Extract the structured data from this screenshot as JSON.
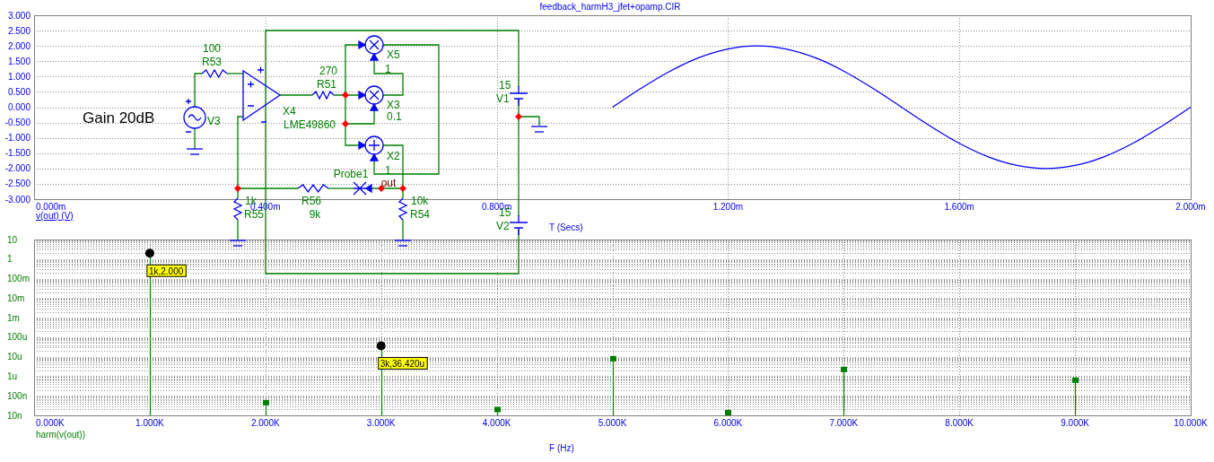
{
  "top_chart": {
    "chart_data": {
      "type": "line",
      "title": "feedback_harmH3_jfet+opamp.CIR",
      "xlabel": "T (Secs)",
      "grid": true,
      "x": [
        1,
        1.05,
        1.1,
        1.15,
        1.2,
        1.25,
        1.3,
        1.35,
        1.4,
        1.45,
        1.5,
        1.55,
        1.6,
        1.65,
        1.7,
        1.75,
        1.8,
        1.85,
        1.9,
        1.95,
        2
      ],
      "series": [
        {
          "name": "v(out) (V)",
          "color": "#0000ff",
          "values": [
            0,
            0.62,
            1.18,
            1.62,
            1.9,
            2,
            1.9,
            1.62,
            1.18,
            0.62,
            0,
            -0.62,
            -1.18,
            -1.62,
            -1.9,
            -2,
            -1.9,
            -1.62,
            -1.18,
            -0.62,
            0
          ]
        }
      ],
      "xlim": [
        0,
        2
      ],
      "ylim": [
        -3,
        3
      ],
      "xticks": [
        {
          "value": 0,
          "label": "0.000m"
        },
        {
          "value": 0.4,
          "label": "0.400m"
        },
        {
          "value": 0.8,
          "label": "0.800m"
        },
        {
          "value": 1.2,
          "label": "1.200m"
        },
        {
          "value": 1.6,
          "label": "1.600m"
        },
        {
          "value": 2,
          "label": "2.000m"
        }
      ],
      "yticks": [
        {
          "value": 3,
          "label": "3.000"
        },
        {
          "value": 2.5,
          "label": "2.500"
        },
        {
          "value": 2,
          "label": "2.000"
        },
        {
          "value": 1.5,
          "label": "1.500"
        },
        {
          "value": 1,
          "label": "1.000"
        },
        {
          "value": 0.5,
          "label": "0.500"
        },
        {
          "value": 0,
          "label": "0.000"
        },
        {
          "value": -0.5,
          "label": "-0.500"
        },
        {
          "value": -1,
          "label": "-1.000"
        },
        {
          "value": -1.5,
          "label": "-1.500"
        },
        {
          "value": -2,
          "label": "-2.000"
        },
        {
          "value": -2.5,
          "label": "-2.500"
        },
        {
          "value": -3,
          "label": "-3.000"
        }
      ]
    }
  },
  "bottom_chart": {
    "y_axis_labels": [
      "10",
      "1",
      "100m",
      "10m",
      "1m",
      "100u",
      "10u",
      "1u",
      "100n",
      "10n"
    ],
    "x_axis_labels": [
      "0.000K",
      "1.000K",
      "2.000K",
      "3.000K",
      "4.000K",
      "5.000K",
      "6.000K",
      "7.000K",
      "8.000K",
      "9.000K",
      "10.000K"
    ],
    "series_label": "harm(v(out))",
    "xlabel": "F (Hz)",
    "cursor_readouts": [
      "1k,2.000",
      "3k,36.420u"
    ]
  },
  "schematic": {
    "annotation": "Gain 20dB",
    "components": [
      {
        "kind": "sine_source",
        "ref": "V3"
      },
      {
        "kind": "resistor",
        "ref": "R53",
        "value": "100"
      },
      {
        "kind": "opamp",
        "ref": "X4",
        "value": "LME49860"
      },
      {
        "kind": "resistor",
        "ref": "R55",
        "value": "1k"
      },
      {
        "kind": "resistor",
        "ref": "R51",
        "value": "270"
      },
      {
        "kind": "resistor",
        "ref": "R56",
        "value": "9k"
      },
      {
        "kind": "multiplier",
        "ref": "X5",
        "value": "1"
      },
      {
        "kind": "multiplier",
        "ref": "X3",
        "value": "0.1"
      },
      {
        "kind": "adder",
        "ref": "X2",
        "value": "1"
      },
      {
        "kind": "probe",
        "ref": "Probe1"
      },
      {
        "kind": "net_label",
        "ref": "out"
      },
      {
        "kind": "resistor",
        "ref": "R54",
        "value": "10k"
      },
      {
        "kind": "battery",
        "ref": "V1",
        "value": "15"
      },
      {
        "kind": "battery",
        "ref": "V2",
        "value": "15"
      }
    ]
  }
}
